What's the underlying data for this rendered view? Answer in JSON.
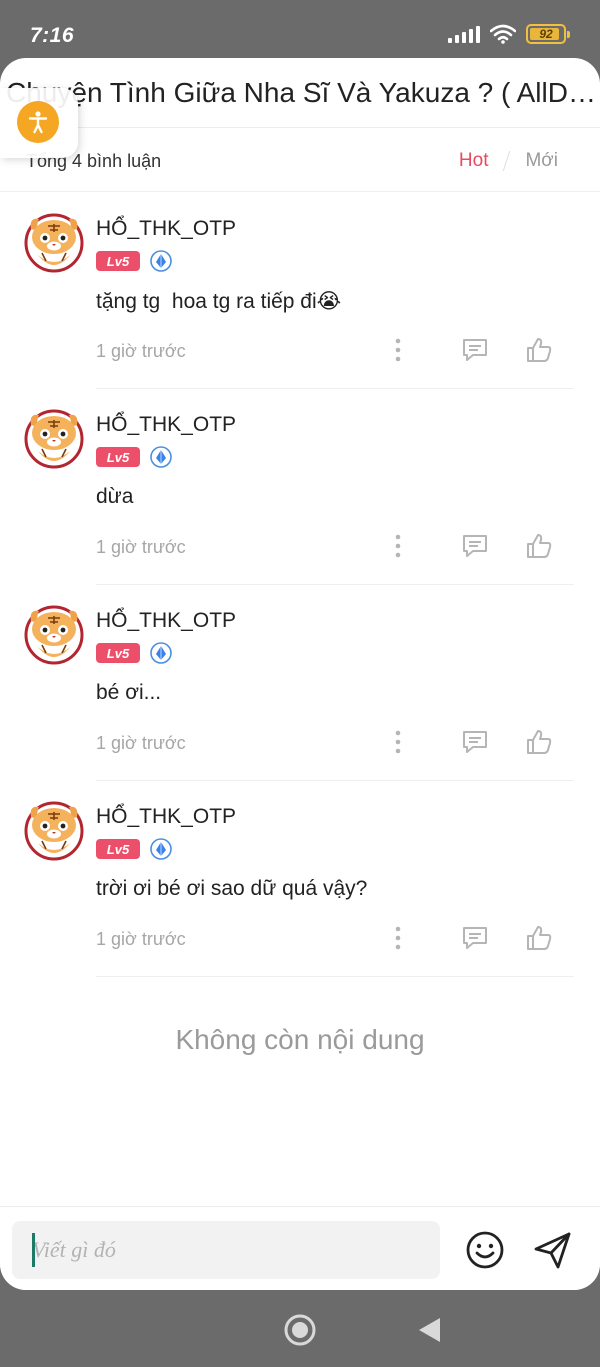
{
  "status_bar": {
    "time": "7:16",
    "battery_level": "92",
    "battery_fraction": 0.92,
    "icons": [
      "signal-icon",
      "wifi-icon",
      "battery-icon"
    ]
  },
  "header": {
    "title": "Chuyện Tình Giữa Nha Sĩ Và Yakuza ? ( AllDa..."
  },
  "summary": {
    "total_label": "Tổng 4 bình luận",
    "sort_hot": "Hot",
    "sort_new": "Mới"
  },
  "comments": [
    {
      "user": "HỔ_THK_OTP",
      "level": "Lv5",
      "text": "tặng tg  hoa tg ra tiếp đi😭",
      "time": "1 giờ trước"
    },
    {
      "user": "HỔ_THK_OTP",
      "level": "Lv5",
      "text": "dừa",
      "time": "1 giờ trước"
    },
    {
      "user": "HỔ_THK_OTP",
      "level": "Lv5",
      "text": "bé ơi...",
      "time": "1 giờ trước"
    },
    {
      "user": "HỔ_THK_OTP",
      "level": "Lv5",
      "text": "trời ơi bé ơi sao dữ quá vậy?",
      "time": "1 giờ trước"
    }
  ],
  "end_message": "Không còn nội dung",
  "composer": {
    "placeholder": "Viết gì đó"
  },
  "colors": {
    "accent_red": "#e84a5f",
    "level_badge": "#ec4f6a",
    "accessibility_orange": "#f5a623",
    "battery": "#e9b53a"
  }
}
